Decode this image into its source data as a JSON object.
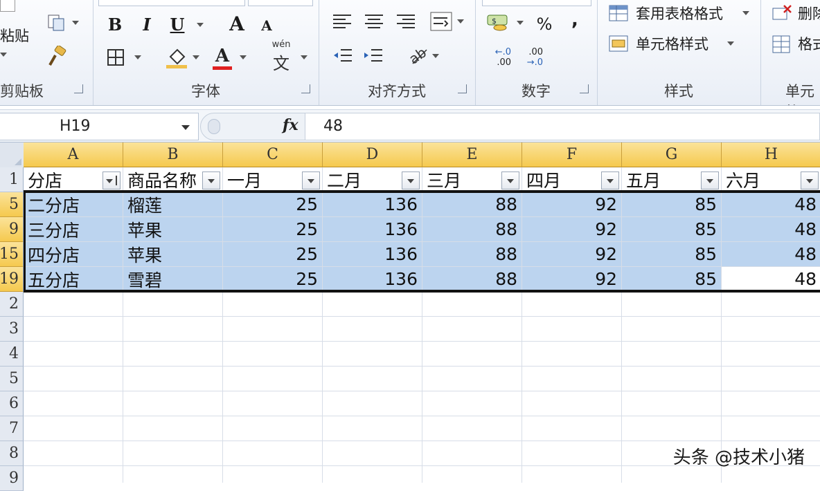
{
  "ribbon": {
    "clipboard": {
      "label": "剪贴板",
      "paste_label": "粘贴"
    },
    "font": {
      "label": "字体",
      "bold": "B",
      "italic": "I",
      "underline": "U",
      "grow": "A",
      "shrink": "A",
      "color_a": "A",
      "phonetic": "wén"
    },
    "alignment": {
      "label": "对齐方式"
    },
    "number": {
      "label": "数字",
      "percent": "%",
      "comma": ",",
      "inc_decimal": ".00",
      "dec_decimal": ".00"
    },
    "styles": {
      "label": "样式",
      "table_format": "套用表格格式",
      "cell_styles": "单元格样式"
    },
    "cells": {
      "label": "单元格",
      "delete": "删除",
      "format": "格式"
    }
  },
  "formula_bar": {
    "name_box": "H19",
    "fx": "fx",
    "value": "48"
  },
  "columns": [
    "A",
    "B",
    "C",
    "D",
    "E",
    "F",
    "G",
    "H"
  ],
  "row_headers": [
    "1",
    "5",
    "9",
    "15",
    "19",
    "2",
    "3",
    "4",
    "5",
    "6",
    "7",
    "8",
    "9"
  ],
  "table": {
    "headers": [
      "分店",
      "商品名称",
      "一月",
      "二月",
      "三月",
      "四月",
      "五月",
      "六月"
    ],
    "rows": [
      [
        "二分店",
        "榴莲",
        "25",
        "136",
        "88",
        "92",
        "85",
        "48"
      ],
      [
        "三分店",
        "苹果",
        "25",
        "136",
        "88",
        "92",
        "85",
        "48"
      ],
      [
        "四分店",
        "苹果",
        "25",
        "136",
        "88",
        "92",
        "85",
        "48"
      ],
      [
        "五分店",
        "雪碧",
        "25",
        "136",
        "88",
        "92",
        "85",
        "48"
      ]
    ]
  },
  "watermark": "头条 @技术小猪",
  "colors": {
    "header_gold": "#f5c94e",
    "selection": "#bcd4ef",
    "grid": "#d7dde7"
  }
}
